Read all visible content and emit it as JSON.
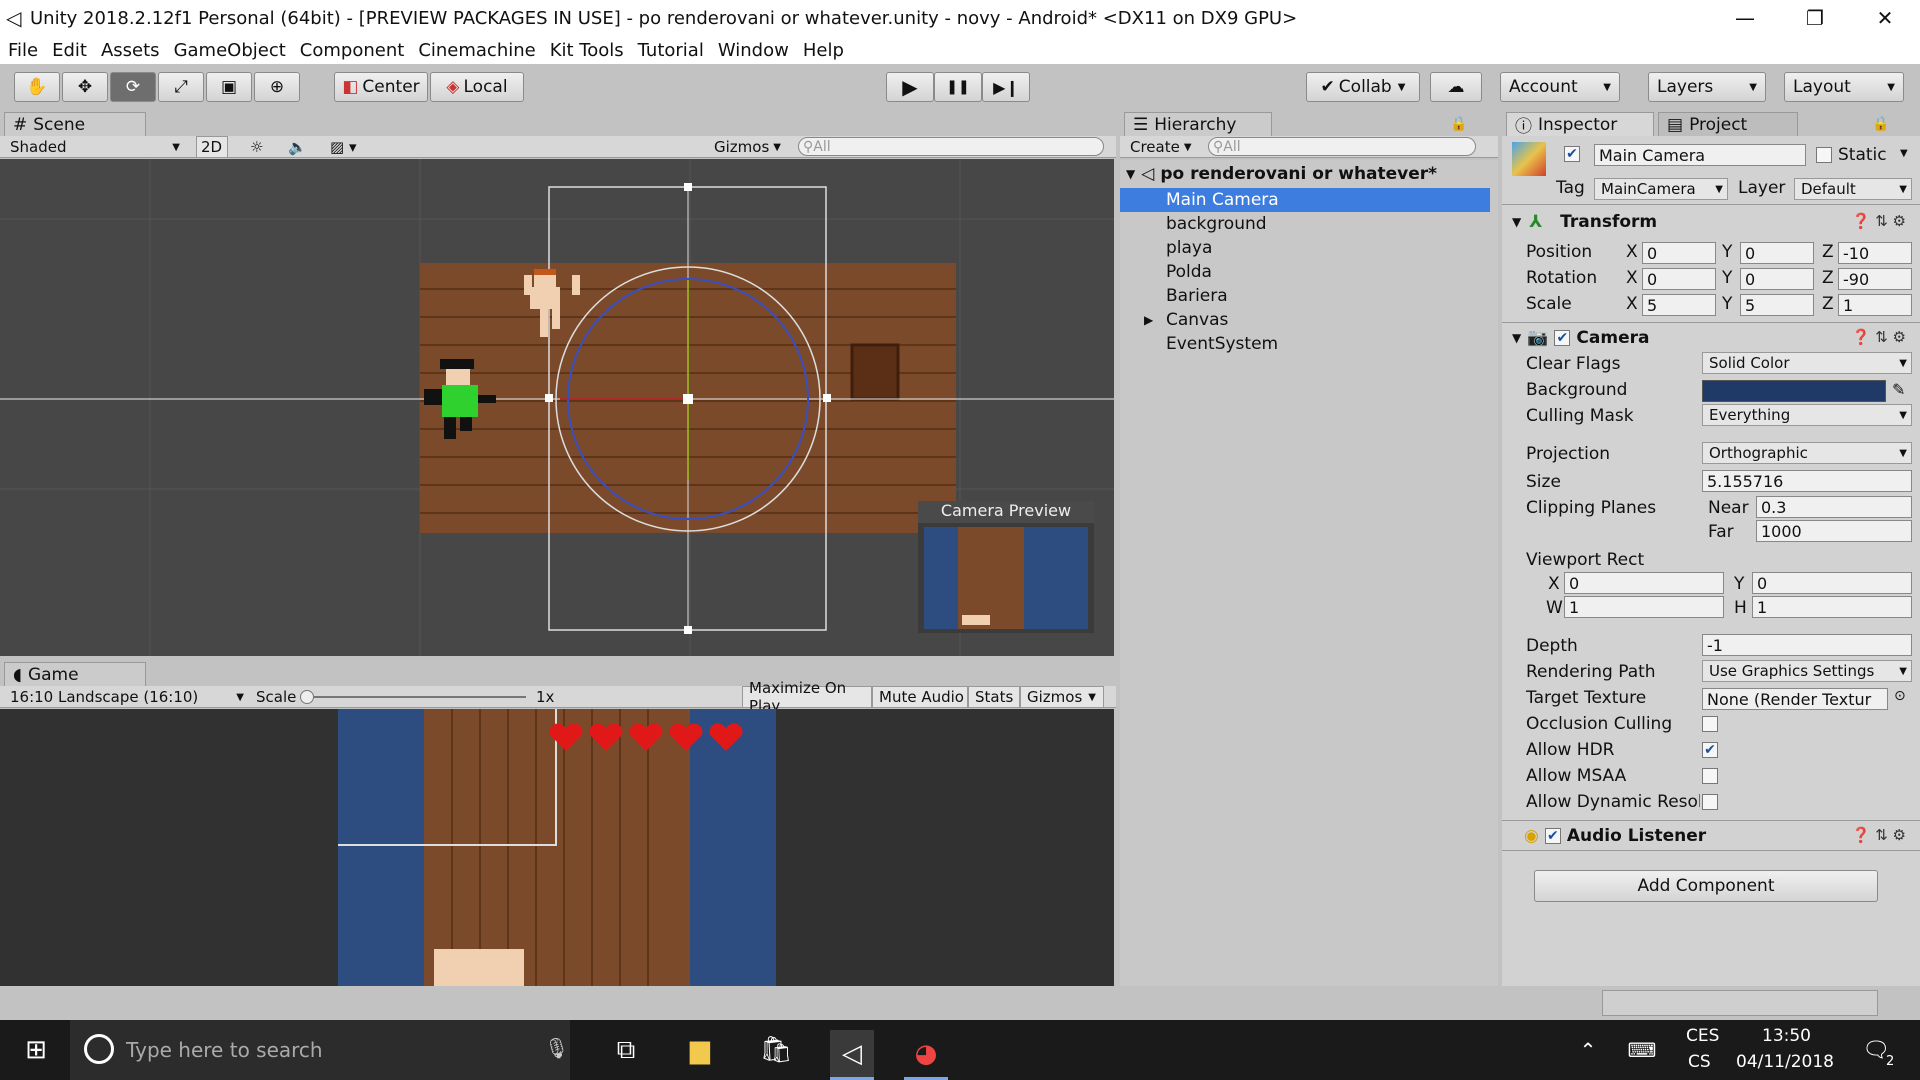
{
  "window": {
    "title": "Unity 2018.2.12f1 Personal (64bit) - [PREVIEW PACKAGES IN USE] - po renderovani or whatever.unity - novy - Android* <DX11 on DX9 GPU>",
    "minimize": "—",
    "maximize": "❐",
    "close": "✕"
  },
  "menu": [
    "File",
    "Edit",
    "Assets",
    "GameObject",
    "Component",
    "Cinemachine",
    "Kit Tools",
    "Tutorial",
    "Window",
    "Help"
  ],
  "toolbar": {
    "pivot": "Center",
    "space": "Local",
    "play": "▶",
    "pause": "❚❚",
    "step": "▶❙",
    "collab": "Collab",
    "account": "Account",
    "layers": "Layers",
    "layout": "Layout"
  },
  "scene": {
    "tab": "Scene",
    "shading": "Shaded",
    "mode2d": "2D",
    "gizmos": "Gizmos",
    "search_placeholder": "All",
    "camera_preview": "Camera Preview"
  },
  "game": {
    "tab": "Game",
    "aspect": "16:10 Landscape (16:10)",
    "scale_label": "Scale",
    "scale_value": "1x",
    "maximize": "Maximize On Play",
    "mute": "Mute Audio",
    "stats": "Stats",
    "gizmos": "Gizmos",
    "hearts": 5
  },
  "hierarchy": {
    "tab": "Hierarchy",
    "create": "Create",
    "search_placeholder": "All",
    "scene_name": "po renderovani or whatever*",
    "items": [
      {
        "label": "Main Camera",
        "selected": true,
        "expandable": false
      },
      {
        "label": "background",
        "selected": false,
        "expandable": false
      },
      {
        "label": "playa",
        "selected": false,
        "expandable": false
      },
      {
        "label": "Polda",
        "selected": false,
        "expandable": false
      },
      {
        "label": "Bariera",
        "selected": false,
        "expandable": false
      },
      {
        "label": "Canvas",
        "selected": false,
        "expandable": true
      },
      {
        "label": "EventSystem",
        "selected": false,
        "expandable": false
      }
    ]
  },
  "inspector": {
    "tab": "Inspector",
    "project_tab": "Project",
    "object_name": "Main Camera",
    "static_label": "Static",
    "tag_label": "Tag",
    "tag_value": "MainCamera",
    "layer_label": "Layer",
    "layer_value": "Default",
    "transform": {
      "title": "Transform",
      "position_label": "Position",
      "position": {
        "x": "0",
        "y": "0",
        "z": "-10"
      },
      "rotation_label": "Rotation",
      "rotation": {
        "x": "0",
        "y": "0",
        "z": "-90"
      },
      "scale_label": "Scale",
      "scale": {
        "x": "5",
        "y": "5",
        "z": "1"
      }
    },
    "camera": {
      "title": "Camera",
      "clear_flags_label": "Clear Flags",
      "clear_flags": "Solid Color",
      "background_label": "Background",
      "background_color": "#1f3a66",
      "culling_label": "Culling Mask",
      "culling": "Everything",
      "projection_label": "Projection",
      "projection": "Orthographic",
      "size_label": "Size",
      "size": "5.155716",
      "clipping_label": "Clipping Planes",
      "near_label": "Near",
      "near": "0.3",
      "far_label": "Far",
      "far": "1000",
      "viewport_label": "Viewport Rect",
      "vx": "0",
      "vy": "0",
      "vw": "1",
      "vh": "1",
      "depth_label": "Depth",
      "depth": "-1",
      "render_path_label": "Rendering Path",
      "render_path": "Use Graphics Settings",
      "target_label": "Target Texture",
      "target": "None (Render Textur",
      "occlusion_label": "Occlusion Culling",
      "occlusion": false,
      "hdr_label": "Allow HDR",
      "hdr": true,
      "msaa_label": "Allow MSAA",
      "msaa": false,
      "dynres_label": "Allow Dynamic Resol",
      "dynres": false
    },
    "audio_listener": "Audio Listener",
    "add_component": "Add Component"
  },
  "taskbar": {
    "search_placeholder": "Type here to search",
    "lang_top": "CES",
    "lang_bottom": "CS",
    "time": "13:50",
    "date": "04/11/2018",
    "notifications": "2"
  }
}
